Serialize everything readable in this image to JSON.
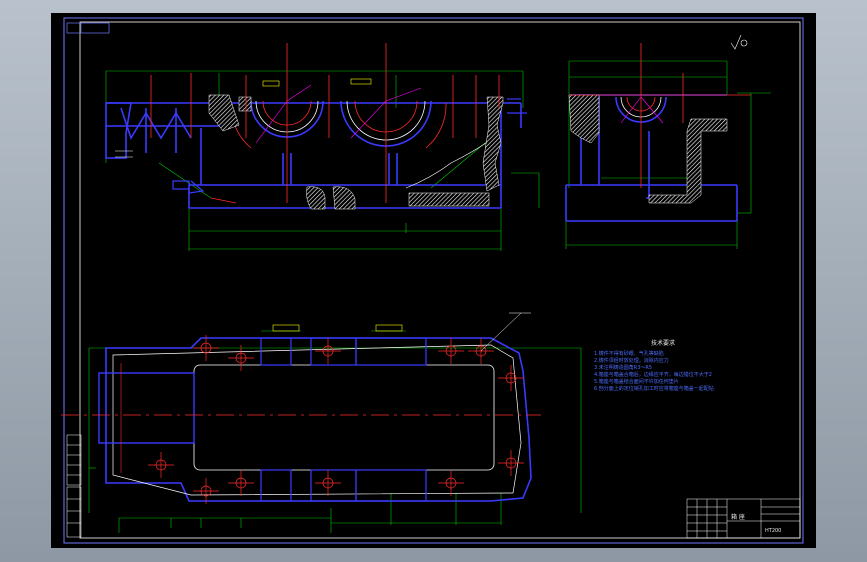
{
  "drawing": {
    "background": "#000000",
    "frame_color": "#6f78ff",
    "outline_color": "#3a3aff",
    "center_color": "#ff2a2a",
    "dim_color": "#00c800",
    "hatch_color": "#ffffff",
    "highlight_color": "#ffff00",
    "accent_color": "#ff00ff"
  },
  "notes": {
    "title": "技术要求",
    "lines": [
      "1.铸件不得有砂眼、气孔等缺陷",
      "2.铸件须经时效处理，消除内应力",
      "3.未注明铸造圆角R3～R5",
      "4.箱座与箱盖合箱后，边缘应平齐，每边错位不大于2",
      "5.箱座与箱盖结合面间不许加任何垫片",
      "6.剖分面上的定位销孔加工时应将箱座与箱盖一起配钻"
    ]
  },
  "title_block": {
    "name": "箱 座",
    "material": "HT200"
  }
}
